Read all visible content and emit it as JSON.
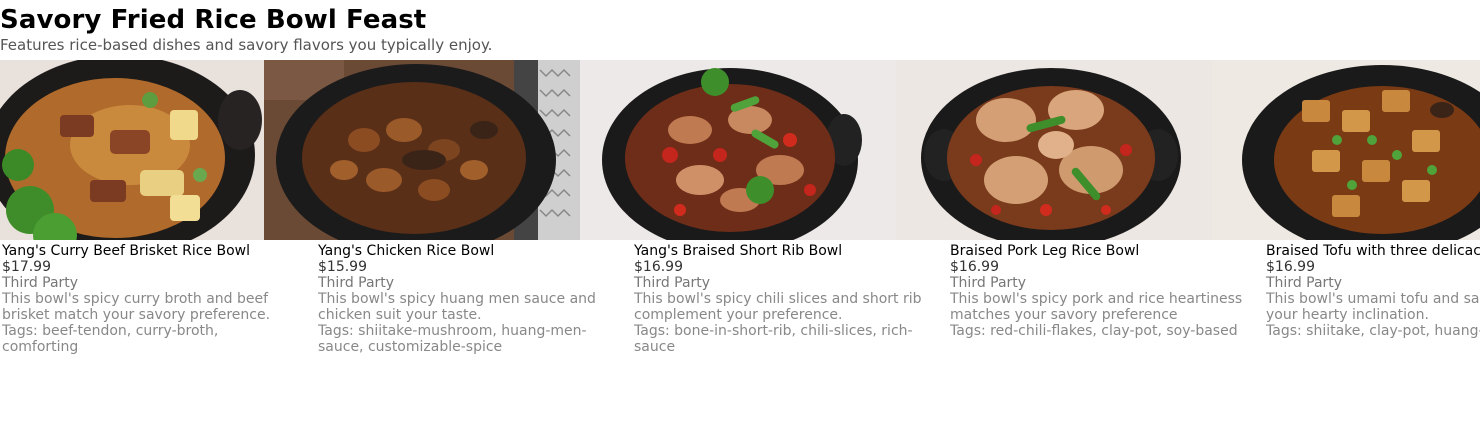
{
  "header": {
    "title": "Savory Fried Rice Bowl Feast",
    "subtitle": "Features rice-based dishes and savory flavors you typically enjoy."
  },
  "products": [
    {
      "name": "Yang's Curry Beef Brisket Rice Bowl",
      "price": "$17.99",
      "vendor": "Third Party",
      "description": "This bowl's spicy curry broth and beef brisket match your savory preference.",
      "tags": "Tags: beef-tendon, curry-broth, comforting",
      "image": "curry-beef-brisket-bowl-photo"
    },
    {
      "name": "Yang's Chicken Rice Bowl",
      "price": "$15.99",
      "vendor": "Third Party",
      "description": "This bowl's spicy huang men sauce and chicken suit your taste.",
      "tags": "Tags: shiitake-mushroom, huang-men-sauce, customizable-spice",
      "image": "chicken-rice-bowl-photo"
    },
    {
      "name": "Yang's Braised Short Rib Bowl",
      "price": "$16.99",
      "vendor": "Third Party",
      "description": "This bowl's spicy chili slices and short rib complement your preference.",
      "tags": "Tags: bone-in-short-rib, chili-slices, rich-sauce",
      "image": "braised-short-rib-bowl-photo"
    },
    {
      "name": "Braised Pork Leg Rice Bowl",
      "price": "$16.99",
      "vendor": "Third Party",
      "description": "This bowl's spicy pork and rice heartiness matches your savory preference",
      "tags": "Tags: red-chili-flakes, clay-pot, soy-based",
      "image": "braised-pork-leg-bowl-photo"
    },
    {
      "name": "Braised Tofu with three delicacies",
      "price": "$16.99",
      "vendor": "Third Party",
      "description": "This bowl's umami tofu and sauce match your hearty inclination.",
      "tags": "Tags: shiitake, clay-pot, huang-men-sauce",
      "image": "braised-tofu-bowl-photo"
    }
  ],
  "colors": {
    "title": "#000000",
    "subtitle": "#555555",
    "price": "#333333",
    "muted": "#888888"
  }
}
